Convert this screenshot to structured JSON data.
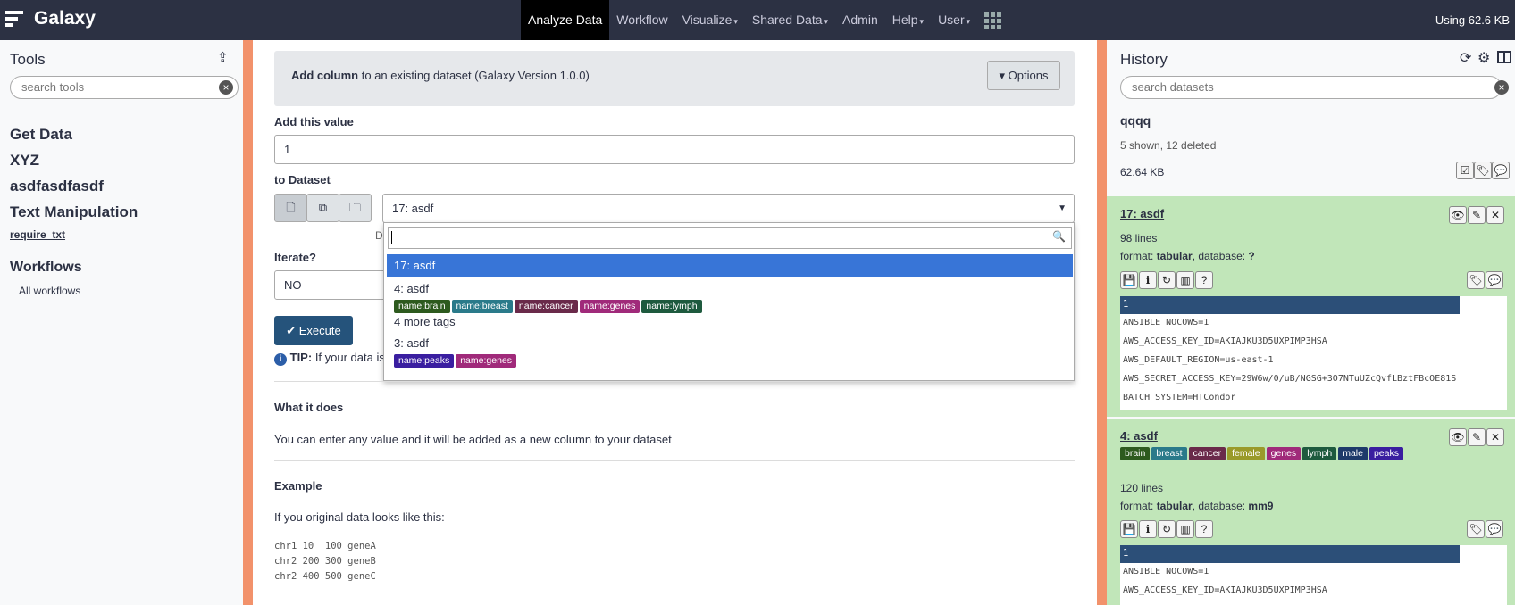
{
  "masthead": {
    "brand": "Galaxy",
    "nav": [
      "Analyze Data",
      "Workflow",
      "Visualize",
      "Shared Data",
      "Admin",
      "Help",
      "User"
    ],
    "usage": "Using 62.6 KB"
  },
  "tools": {
    "title": "Tools",
    "search_placeholder": "search tools",
    "sections": [
      "Get Data",
      "XYZ",
      "asdfasdfasdf",
      "Text Manipulation"
    ],
    "sub_item": "require_txt",
    "workflows_title": "Workflows",
    "all_workflows": "All workflows"
  },
  "form": {
    "tool_name": "Add column",
    "tool_desc": "to an existing dataset (Galaxy Version 1.0.0)",
    "options_label": "Options",
    "value_label": "Add this value",
    "value": "1",
    "dataset_label": "to Dataset",
    "dataset_selected": "17: asdf",
    "iterate_label": "Iterate?",
    "iterate_value": "NO",
    "execute_label": "Execute",
    "tip_bold": "TIP:",
    "tip_text": "If your data is",
    "under_select": "D",
    "dropdown": {
      "highlight": "17: asdf",
      "opt2": "4: asdf",
      "opt2_tags": [
        "name:brain",
        "name:breast",
        "name:cancer",
        "name:genes",
        "name:lymph"
      ],
      "more_tags": "4 more tags",
      "opt3": "3: asdf",
      "opt3_tags": [
        "name:peaks",
        "name:genes"
      ]
    },
    "what_title": "What it does",
    "what_text": "You can enter any value and it will be added as a new column to your dataset",
    "example_title": "Example",
    "example_text": "If you original data looks like this:",
    "example_rows": [
      "chr1 10  100 geneA",
      "chr2 200 300 geneB",
      "chr2 400 500 geneC"
    ]
  },
  "history": {
    "title": "History",
    "search_placeholder": "search datasets",
    "name": "qqqq",
    "counts": "5 shown, 12 deleted",
    "size": "62.64 KB",
    "d1": {
      "title": "17: asdf",
      "lines": "98 lines",
      "format_label": "format: ",
      "format": "tabular",
      "db_label": ", database: ",
      "db": "?",
      "peek_header": "1",
      "peek_rows": [
        "ANSIBLE_NOCOWS=1",
        "AWS_ACCESS_KEY_ID=AKIAJKU3D5UXPIMP3HSA",
        "AWS_DEFAULT_REGION=us-east-1",
        "AWS_SECRET_ACCESS_KEY=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",
        "BATCH_SYSTEM=HTCondor"
      ]
    },
    "d2": {
      "title": "4: asdf",
      "tags": [
        "brain",
        "breast",
        "cancer",
        "female",
        "genes",
        "lymph",
        "male",
        "peaks"
      ],
      "lines": "120 lines",
      "format_label": "format: ",
      "format": "tabular",
      "db_label": ", database: ",
      "db": "mm9",
      "peek_header": "1",
      "peek_rows": [
        "ANSIBLE_NOCOWS=1",
        "AWS_ACCESS_KEY_ID=AKIAJKU3D5UXPIMP3HSA"
      ]
    }
  },
  "colors": {
    "masthead": "#2c3143",
    "panel_border": "#f2926b",
    "dataset_ok": "#c1e6b9",
    "highlight": "#3875d7",
    "primary_button": "#25537b"
  }
}
